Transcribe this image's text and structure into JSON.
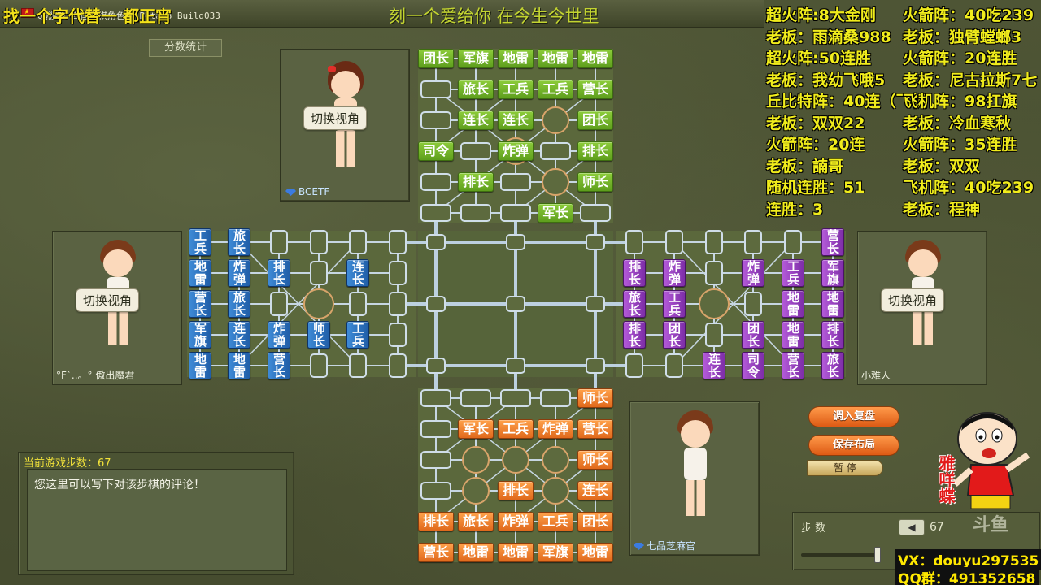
{
  "window": {
    "title": "QQ游戏 四国军棋角色版 Beta08 Build033",
    "overlay_title": "找一个字代替一 都正宵",
    "marquee": "刻一个爱给你 在今生今世里"
  },
  "stats_overlay": {
    "left_column": [
      "超火阵:8大金刚",
      "老板：雨滴桑988",
      "超火阵:50连胜",
      "老板：我幼飞哦5",
      "丘比特阵：40连（飞机",
      "老板：双双22",
      "火箭阵：20连",
      "老板：諵哥",
      "随机连胜：51",
      "连胜：3"
    ],
    "right_column": [
      "火箭阵：40吃239",
      "老板：独臂螳螂3",
      "火箭阵：20连胜",
      "老板：尼古拉斯7七",
      "飞机阵：98扛旗",
      "老板：冷血寒秋",
      "火箭阵：35连胜",
      "老板：双双",
      "飞机阵：40吃239",
      "老板：程神"
    ]
  },
  "score_stats_button": "分数统计",
  "toggle_view_label": "切换视角",
  "players": {
    "top": {
      "name": "BCETF"
    },
    "left": {
      "name": "°F`..。° 傲出魔君"
    },
    "right": {
      "name": "小难人"
    },
    "bottom": {
      "name": "七品芝麻官"
    }
  },
  "board": {
    "top_pieces": [
      "团长",
      "军旗",
      "地雷",
      "地雷",
      "地雷",
      "旅长",
      "工兵",
      "工兵",
      "营长",
      "连长",
      "连长",
      "团长",
      "司令",
      "炸弹",
      "排长",
      "排长",
      "师长",
      "军长"
    ],
    "bottom_pieces": [
      "师长",
      "军长",
      "工兵",
      "炸弹",
      "营长",
      "师长",
      "排长",
      "连长",
      "排长",
      "旅长",
      "炸弹",
      "工兵",
      "团长",
      "营长",
      "地雷",
      "地雷",
      "军旗",
      "地雷"
    ],
    "left_pieces": [
      "工兵",
      "旅长",
      "地雷",
      "炸弹",
      "排长",
      "连长",
      "营长",
      "旅长",
      "军旗",
      "连长",
      "炸弹",
      "师长",
      "工兵",
      "地雷",
      "地雷",
      "营长"
    ],
    "right_pieces": [
      "营长",
      "排长",
      "炸弹",
      "炸弹",
      "工兵",
      "军旗",
      "旅长",
      "工兵",
      "地雷",
      "地雷",
      "排长",
      "团长",
      "团长",
      "地雷",
      "排长",
      "连长",
      "司令",
      "营长",
      "旅长"
    ]
  },
  "controls": {
    "load_replay": "调入复盘",
    "save_layout": "保存布局",
    "pause": "暂  停",
    "steps_label": "步  数",
    "steps_value": "67"
  },
  "comment": {
    "header": "当前游戏步数：67",
    "placeholder": "您这里可以写下对该步棋的评论！"
  },
  "contact": {
    "vx": "VX：douyu297535",
    "qq": "QQ群：491352658"
  },
  "watermark": "斗鱼",
  "cartoon_text": "雅咩蝶",
  "colors": {
    "stat_text": "#f0ec1c",
    "green_piece": "#6fb02a",
    "orange_piece": "#ee7a2a",
    "blue_piece": "#2c70c0",
    "purple_piece": "#9444c0"
  }
}
